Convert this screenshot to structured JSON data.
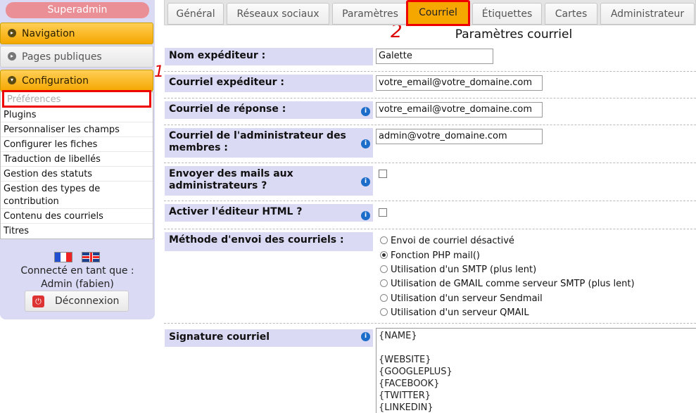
{
  "sidebar": {
    "superadmin": "Superadmin",
    "navigation": "Navigation",
    "public_pages": "Pages publiques",
    "configuration": "Configuration",
    "items": [
      "Préférences",
      "Plugins",
      "Personnaliser les champs",
      "Configurer les fiches",
      "Traduction de libellés",
      "Gestion des statuts",
      "Gestion des types de contribution",
      "Contenu des courriels",
      "Titres"
    ],
    "connected_as": "Connecté en tant que :",
    "user": "Admin (fabien)",
    "logout": "Déconnexion"
  },
  "annotations": {
    "one": "1",
    "two": "2"
  },
  "tabs": [
    "Général",
    "Réseaux sociaux",
    "Paramètres",
    "Courriel",
    "Étiquettes",
    "Cartes",
    "Administrateur"
  ],
  "active_tab": "Courriel",
  "page_title": "Paramètres courriel",
  "form": {
    "sender_name_label": "Nom expéditeur :",
    "sender_name_value": "Galette",
    "sender_email_label": "Courriel expéditeur :",
    "sender_email_value": "votre_email@votre_domaine.com",
    "reply_to_label": "Courriel de réponse :",
    "reply_to_value": "votre_email@votre_domaine.com",
    "admin_email_label": "Courriel de l'administrateur des membres :",
    "admin_email_value": "admin@votre_domaine.com",
    "mail_admins_label": "Envoyer des mails aux administrateurs ?",
    "mail_admins_checked": false,
    "html_editor_label": "Activer l'éditeur HTML ?",
    "html_editor_checked": false,
    "method_label": "Méthode d'envoi des courriels :",
    "methods": [
      "Envoi de courriel désactivé",
      "Fonction PHP mail()",
      "Utilisation d'un SMTP (plus lent)",
      "Utilisation de GMAIL comme serveur SMTP (plus lent)",
      "Utilisation d'un serveur Sendmail",
      "Utilisation d'un serveur QMAIL"
    ],
    "selected_method": "Fonction PHP mail()",
    "signature_label": "Signature courriel",
    "signature_value": "{NAME}\n\n{WEBSITE}\n{GOOGLEPLUS}\n{FACEBOOK}\n{TWITTER}\n{LINKEDIN}"
  },
  "colors": {
    "accent": "#f5a700",
    "highlight": "#e00000",
    "label_bg": "#dadaf5",
    "info": "#1c6cc9"
  }
}
